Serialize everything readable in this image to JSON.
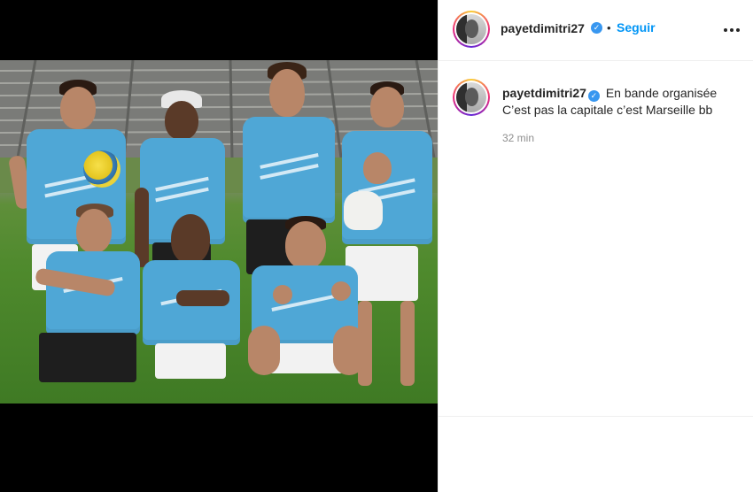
{
  "post": {
    "author": {
      "username": "payetdimitri27",
      "verified_icon": "verified-badge-icon"
    },
    "follow_separator": "•",
    "follow_label": "Seguir",
    "more_icon": "more-horizontal-icon",
    "caption": {
      "username": "payetdimitri27",
      "line1": "En bande organisée",
      "line2": "C’est pas la capitale c’est Marseille bb"
    },
    "timestamp": "32 min"
  },
  "colors": {
    "link_blue": "#0095f6",
    "verified_blue": "#3897f0",
    "jersey_blue": "#4fa7d6",
    "media_background": "#000000"
  }
}
